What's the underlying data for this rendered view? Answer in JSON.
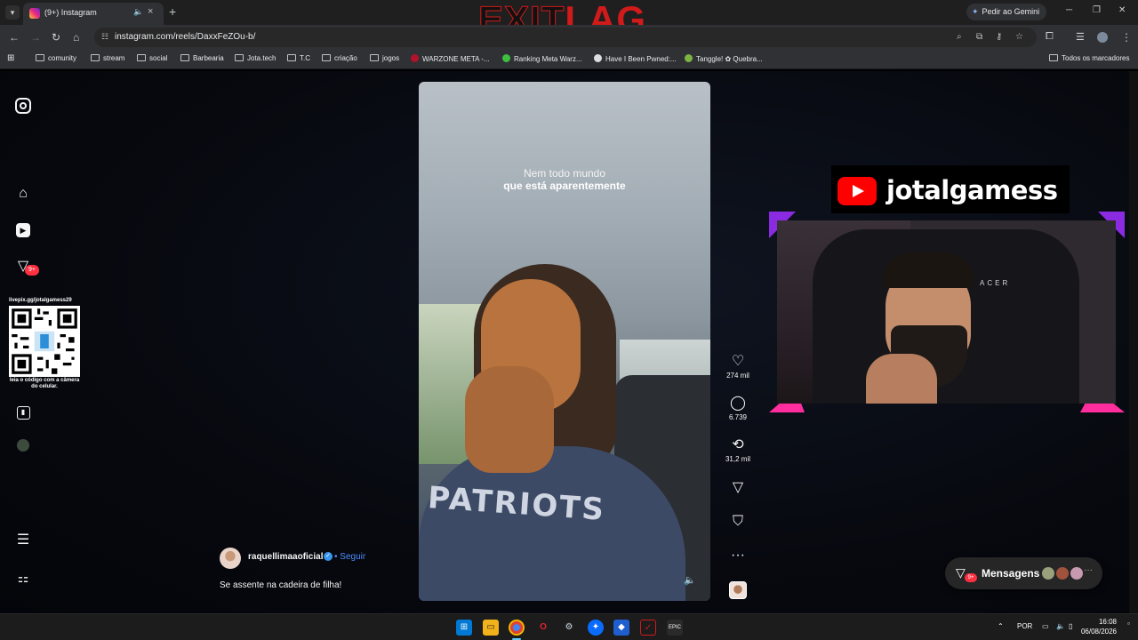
{
  "browser": {
    "tab_title": "(9+) Instagram",
    "new_tab_glyph": "+",
    "gemini_label": "Pedir ao Gemini",
    "url": "instagram.com/reels/DaxxFeZOu-b/",
    "bookmarks": [
      "comunity",
      "stream",
      "social",
      "Barbearia",
      "Jota.tech",
      "T.C",
      "criação",
      "jogos",
      "WARZONE META -...",
      "Ranking Meta Warz...",
      "Have I Been Pwned:...",
      "Tanggle! ✿ Quebra..."
    ],
    "all_bookmarks_label": "Todos os marcadores"
  },
  "watermark": {
    "part1": "EXIT",
    "part2": "LAG"
  },
  "sidebar": {
    "icons": [
      "instagram-icon",
      "home-icon",
      "reels-icon",
      "messages-icon",
      "stats-icon",
      "profile-icon",
      "menu-icon",
      "apps-icon"
    ],
    "notification_count": "9+"
  },
  "qr_overlay": {
    "url": "livepix.gg/jotalgamess29",
    "caption": "leia o código com a câmera do celular."
  },
  "reel": {
    "caption_line1": "Nem todo mundo",
    "caption_line2": "que está aparentemente",
    "shirt_text": "PATRIOTS",
    "author": "raquellimaaoficial",
    "follow_label": "• Seguir",
    "description": "Se assente na cadeira de filha!",
    "likes": "274 mil",
    "comments": "6.739",
    "reposts": "31,2 mil"
  },
  "stream_overlay": {
    "channel": "jotalgamess",
    "chair_brand": "ACER"
  },
  "messages": {
    "label": "Mensagens",
    "badge": "9+"
  },
  "taskbar": {
    "language": "POR",
    "time": "16:08",
    "date": "06/08/2026"
  },
  "colors": {
    "instagram_bg": "#07090f",
    "accent_blue": "#4a8cff",
    "badge_red": "#ff3040",
    "youtube_red": "#ff0000"
  }
}
